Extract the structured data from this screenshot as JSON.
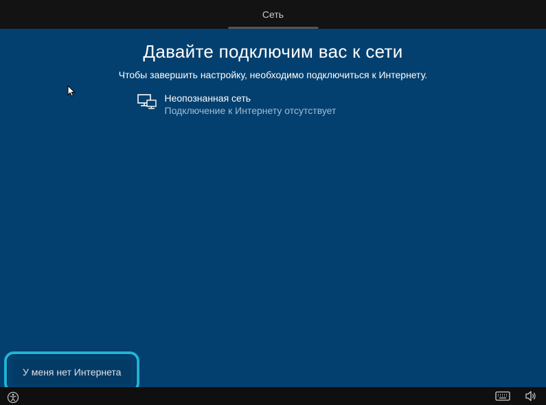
{
  "topbar": {
    "tab_label": "Сеть"
  },
  "main": {
    "title": "Давайте подключим вас к сети",
    "subtitle": "Чтобы завершить настройку, необходимо подключиться к Интернету.",
    "network": {
      "name": "Неопознанная сеть",
      "status": "Подключение к Интернету отсутствует"
    }
  },
  "buttons": {
    "no_internet": "У меня нет Интернета"
  },
  "icons": {
    "network": "network-monitor-icon",
    "ease_of_access": "ease-of-access-icon",
    "keyboard": "keyboard-icon",
    "volume": "volume-icon"
  }
}
